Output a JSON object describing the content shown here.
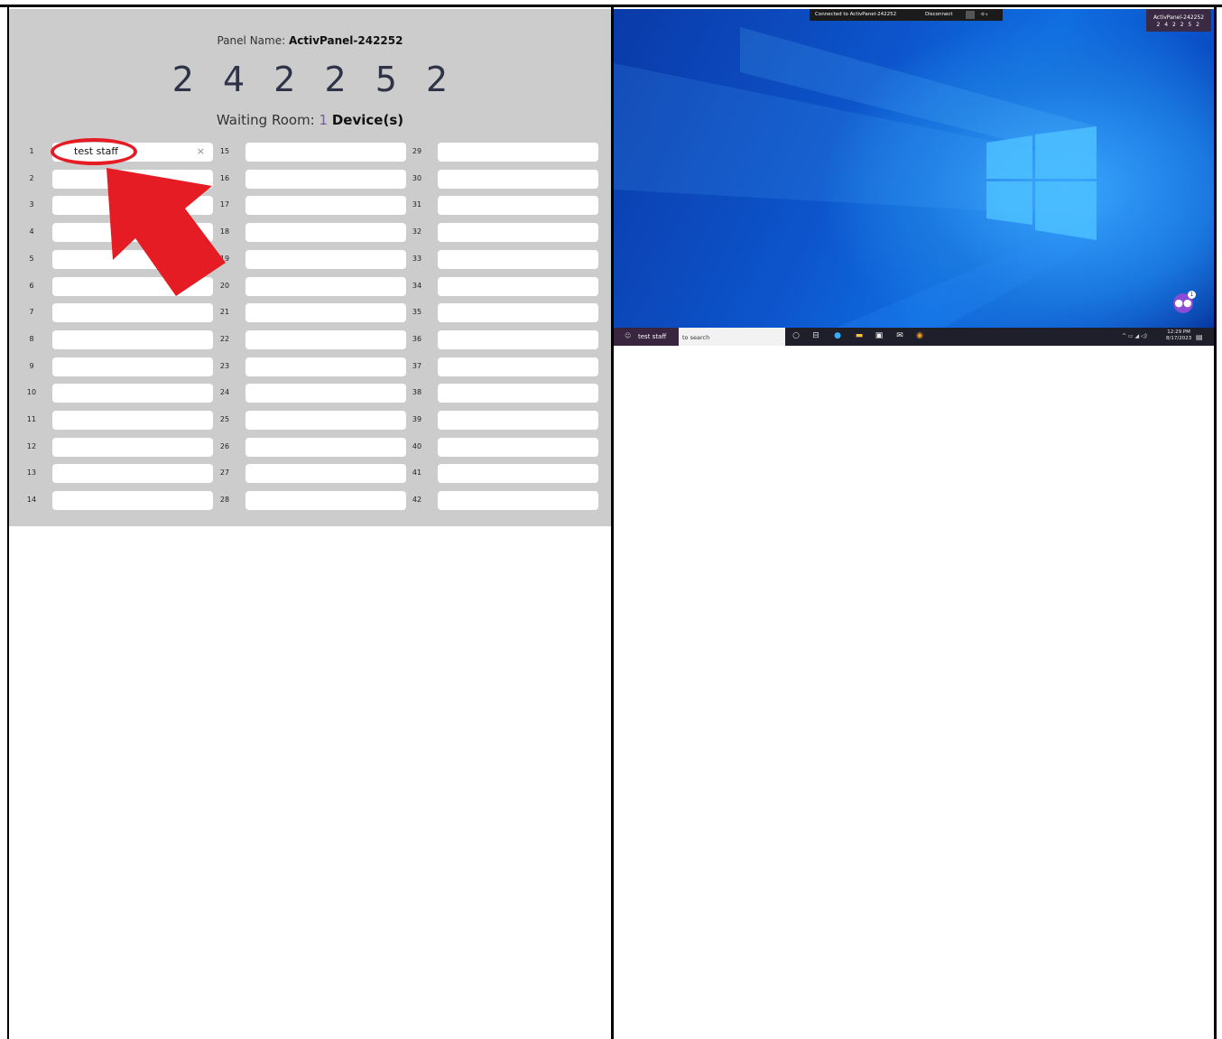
{
  "panel": {
    "name_label": "Panel Name:",
    "name_value": "ActivPanel-242252",
    "code_digits": "2 4 2 2 5 2",
    "waiting_label": "Waiting Room:",
    "waiting_count": "1",
    "waiting_unit": "Device(s)"
  },
  "slots": {
    "col1": [
      {
        "num": "1",
        "text": "test staff",
        "clear": "×"
      },
      {
        "num": "2",
        "text": ""
      },
      {
        "num": "3",
        "text": ""
      },
      {
        "num": "4",
        "text": ""
      },
      {
        "num": "5",
        "text": ""
      },
      {
        "num": "6",
        "text": ""
      },
      {
        "num": "7",
        "text": ""
      },
      {
        "num": "8",
        "text": ""
      },
      {
        "num": "9",
        "text": ""
      },
      {
        "num": "10",
        "text": ""
      },
      {
        "num": "11",
        "text": ""
      },
      {
        "num": "12",
        "text": ""
      },
      {
        "num": "13",
        "text": ""
      },
      {
        "num": "14",
        "text": ""
      }
    ],
    "col2": [
      {
        "num": "15"
      },
      {
        "num": "16"
      },
      {
        "num": "17"
      },
      {
        "num": "18"
      },
      {
        "num": "19"
      },
      {
        "num": "20"
      },
      {
        "num": "21"
      },
      {
        "num": "22"
      },
      {
        "num": "23"
      },
      {
        "num": "24"
      },
      {
        "num": "25"
      },
      {
        "num": "26"
      },
      {
        "num": "27"
      },
      {
        "num": "28"
      }
    ],
    "col3": [
      {
        "num": "29"
      },
      {
        "num": "30"
      },
      {
        "num": "31"
      },
      {
        "num": "32"
      },
      {
        "num": "33"
      },
      {
        "num": "34"
      },
      {
        "num": "35"
      },
      {
        "num": "36"
      },
      {
        "num": "37"
      },
      {
        "num": "38"
      },
      {
        "num": "39"
      },
      {
        "num": "40"
      },
      {
        "num": "41"
      },
      {
        "num": "42"
      }
    ]
  },
  "remote": {
    "connection_text": "Connected to ActivPanel-242252",
    "disconnect_label": "Disconnect",
    "badge_name": "ActivPanel-242252",
    "badge_code": "2 4 2 2 5 2",
    "people_badge_count": "1",
    "taskbar_user": "test staff",
    "search_placeholder": "to search",
    "clock_time": "12:29 PM",
    "clock_date": "8/17/2023"
  },
  "colors": {
    "panel_bg": "#cccccc",
    "digits": "#2e3347",
    "waiting_count": "#7a5c9a",
    "annotation_red": "#e51c23",
    "desktop_blue": "#0d55cc"
  }
}
